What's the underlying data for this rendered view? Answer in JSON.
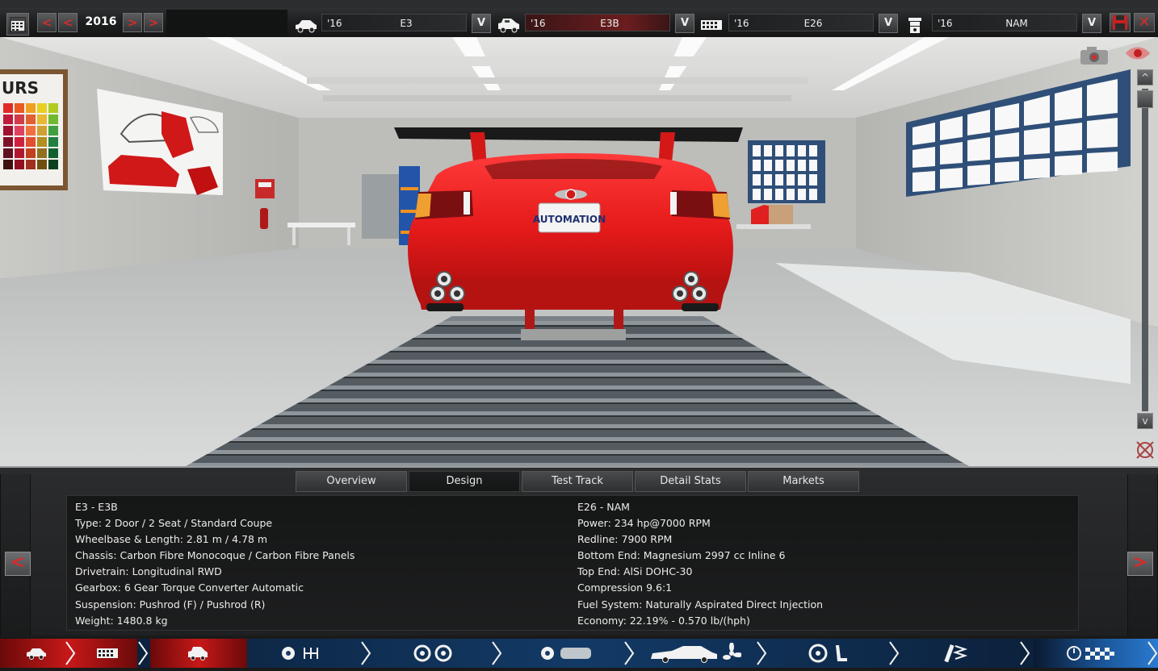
{
  "topbar": {
    "year": "2016",
    "prev_button": "<",
    "prev2_button": "<",
    "next_button": ">",
    "next2_button": ">",
    "selectors": [
      {
        "icon": "car-body-icon",
        "year": "'16",
        "name": "E3",
        "dropdown": "V"
      },
      {
        "icon": "car-trim-icon",
        "year": "'16",
        "name": "E3B",
        "dropdown": "V"
      },
      {
        "icon": "engine-block-icon",
        "year": "'16",
        "name": "E26",
        "dropdown": "V"
      },
      {
        "icon": "piston-icon",
        "year": "'16",
        "name": "NAM",
        "dropdown": "V"
      }
    ],
    "save_icon": "save-icon",
    "close_label": "✕"
  },
  "viewport": {
    "plate_text": "AUTOMATION",
    "poster_text": "URS",
    "scroll_up": "^",
    "scroll_down": "v"
  },
  "panel": {
    "tabs": [
      "Overview",
      "Design",
      "Test Track",
      "Detail Stats",
      "Markets"
    ],
    "active_tab": "Design",
    "prev_button": "<",
    "next_button": ">",
    "left_stats": [
      "E3 - E3B",
      "Type: 2 Door / 2 Seat / Standard Coupe",
      "Wheelbase & Length: 2.81 m / 4.78 m",
      "Chassis: Carbon Fibre Monocoque / Carbon Fibre Panels",
      "Drivetrain: Longitudinal RWD",
      "Gearbox: 6 Gear Torque Converter Automatic",
      "Suspension: Pushrod (F) / Pushrod (R)",
      "Weight: 1480.8 kg"
    ],
    "right_stats": [
      "E26 - NAM",
      "Power: 234 hp@7000 RPM",
      "Redline: 7900 RPM",
      "Bottom End: Magnesium 2997 cc Inline 6",
      "Top End: AlSi DOHC-30",
      "Compression 9.6:1",
      "Fuel System: Naturally Aspirated Direct Injection",
      "Economy: 22.19% - 0.570 lb/(hph)"
    ]
  },
  "bottomnav": {
    "items": [
      {
        "icon": "car-model-icon"
      },
      {
        "icon": "engine-model-icon"
      },
      {
        "icon": "trim-design-icon"
      },
      {
        "icon": "gearbox-icon"
      },
      {
        "icon": "wheels-icon"
      },
      {
        "icon": "aero-styling-icon"
      },
      {
        "icon": "interior-icon"
      },
      {
        "icon": "suspension-icon"
      },
      {
        "icon": "testing-icon"
      }
    ],
    "active_index": 2
  },
  "colors": {
    "car_red": "#e51a1a",
    "accent_red": "#d62c2c",
    "nav_blue": "#0d2a4d"
  }
}
